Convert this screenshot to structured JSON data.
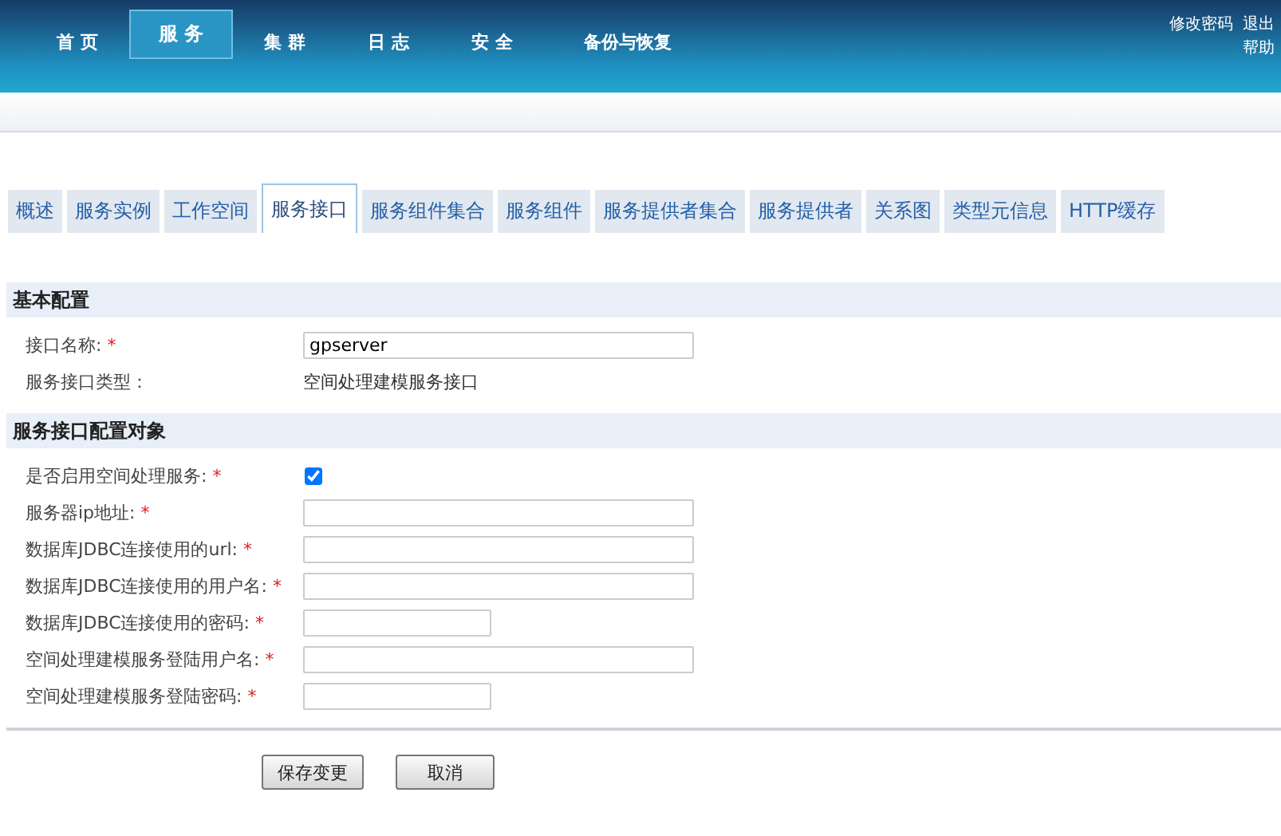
{
  "nav": [
    {
      "label": "首 页",
      "selected": false
    },
    {
      "label": "服 务",
      "selected": true
    },
    {
      "label": "集 群",
      "selected": false
    },
    {
      "label": "日 志",
      "selected": false
    },
    {
      "label": "安 全",
      "selected": false
    },
    {
      "label": "备份与恢复",
      "selected": false
    }
  ],
  "user_links": [
    "修改密码",
    "退出",
    "帮助"
  ],
  "tabs": [
    {
      "label": "概述",
      "selected": false
    },
    {
      "label": "服务实例",
      "selected": false
    },
    {
      "label": "工作空间",
      "selected": false
    },
    {
      "label": "服务接口",
      "selected": true
    },
    {
      "label": "服务组件集合",
      "selected": false
    },
    {
      "label": "服务组件",
      "selected": false
    },
    {
      "label": "服务提供者集合",
      "selected": false
    },
    {
      "label": "服务提供者",
      "selected": false
    },
    {
      "label": "关系图",
      "selected": false
    },
    {
      "label": "类型元信息",
      "selected": false
    },
    {
      "label": "HTTP缓存",
      "selected": false
    }
  ],
  "sections": [
    {
      "title": "基本配置",
      "rows": [
        {
          "label": "接口名称:",
          "required_mark": "*",
          "kind": "text",
          "value": "gpserver"
        },
        {
          "label": "服务接口类型：",
          "kind": "static",
          "value": "空间处理建模服务接口"
        }
      ]
    },
    {
      "title": "服务接口配置对象",
      "rows": [
        {
          "label": "是否启用空间处理服务:",
          "required_mark": "*",
          "kind": "checkbox",
          "checked": true
        },
        {
          "label": "服务器ip地址:",
          "required_mark": "*",
          "kind": "text"
        },
        {
          "label": "数据库JDBC连接使用的url:",
          "required_mark": "*",
          "kind": "text"
        },
        {
          "label": "数据库JDBC连接使用的用户名:",
          "required_mark": "*",
          "kind": "text"
        },
        {
          "label": "数据库JDBC连接使用的密码:",
          "required_mark": "*",
          "kind": "short-text"
        },
        {
          "label": "空间处理建模服务登陆用户名:",
          "required_mark": "*",
          "kind": "text"
        },
        {
          "label": "空间处理建模服务登陆密码:",
          "required_mark": "*",
          "kind": "short-text"
        }
      ]
    }
  ],
  "buttons": [
    "保存变更",
    "取消"
  ]
}
